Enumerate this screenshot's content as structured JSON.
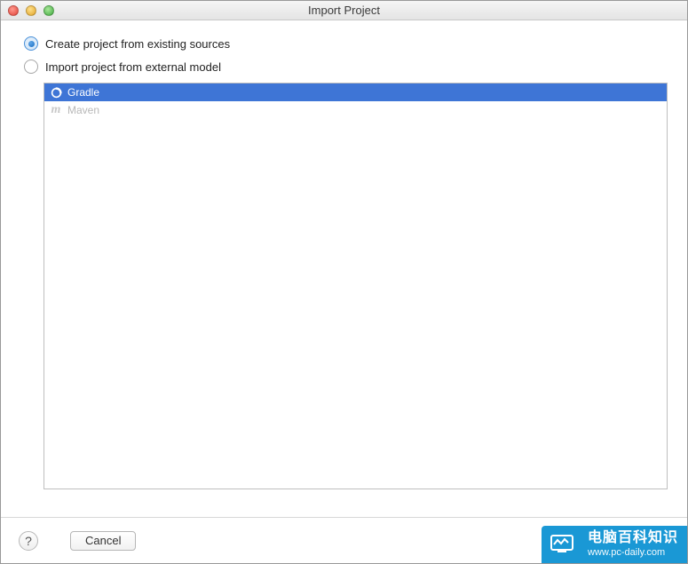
{
  "window": {
    "title": "Import Project"
  },
  "options": {
    "create_from_sources": "Create project from existing sources",
    "import_external": "Import project from external model"
  },
  "models": [
    {
      "icon": "gradle-icon",
      "label": "Gradle",
      "selected": true
    },
    {
      "icon": "maven-icon",
      "label": "Maven",
      "selected": false
    }
  ],
  "footer": {
    "help": "?",
    "cancel": "Cancel"
  },
  "watermark": {
    "title": "电脑百科知识",
    "url": "www.pc-daily.com"
  }
}
